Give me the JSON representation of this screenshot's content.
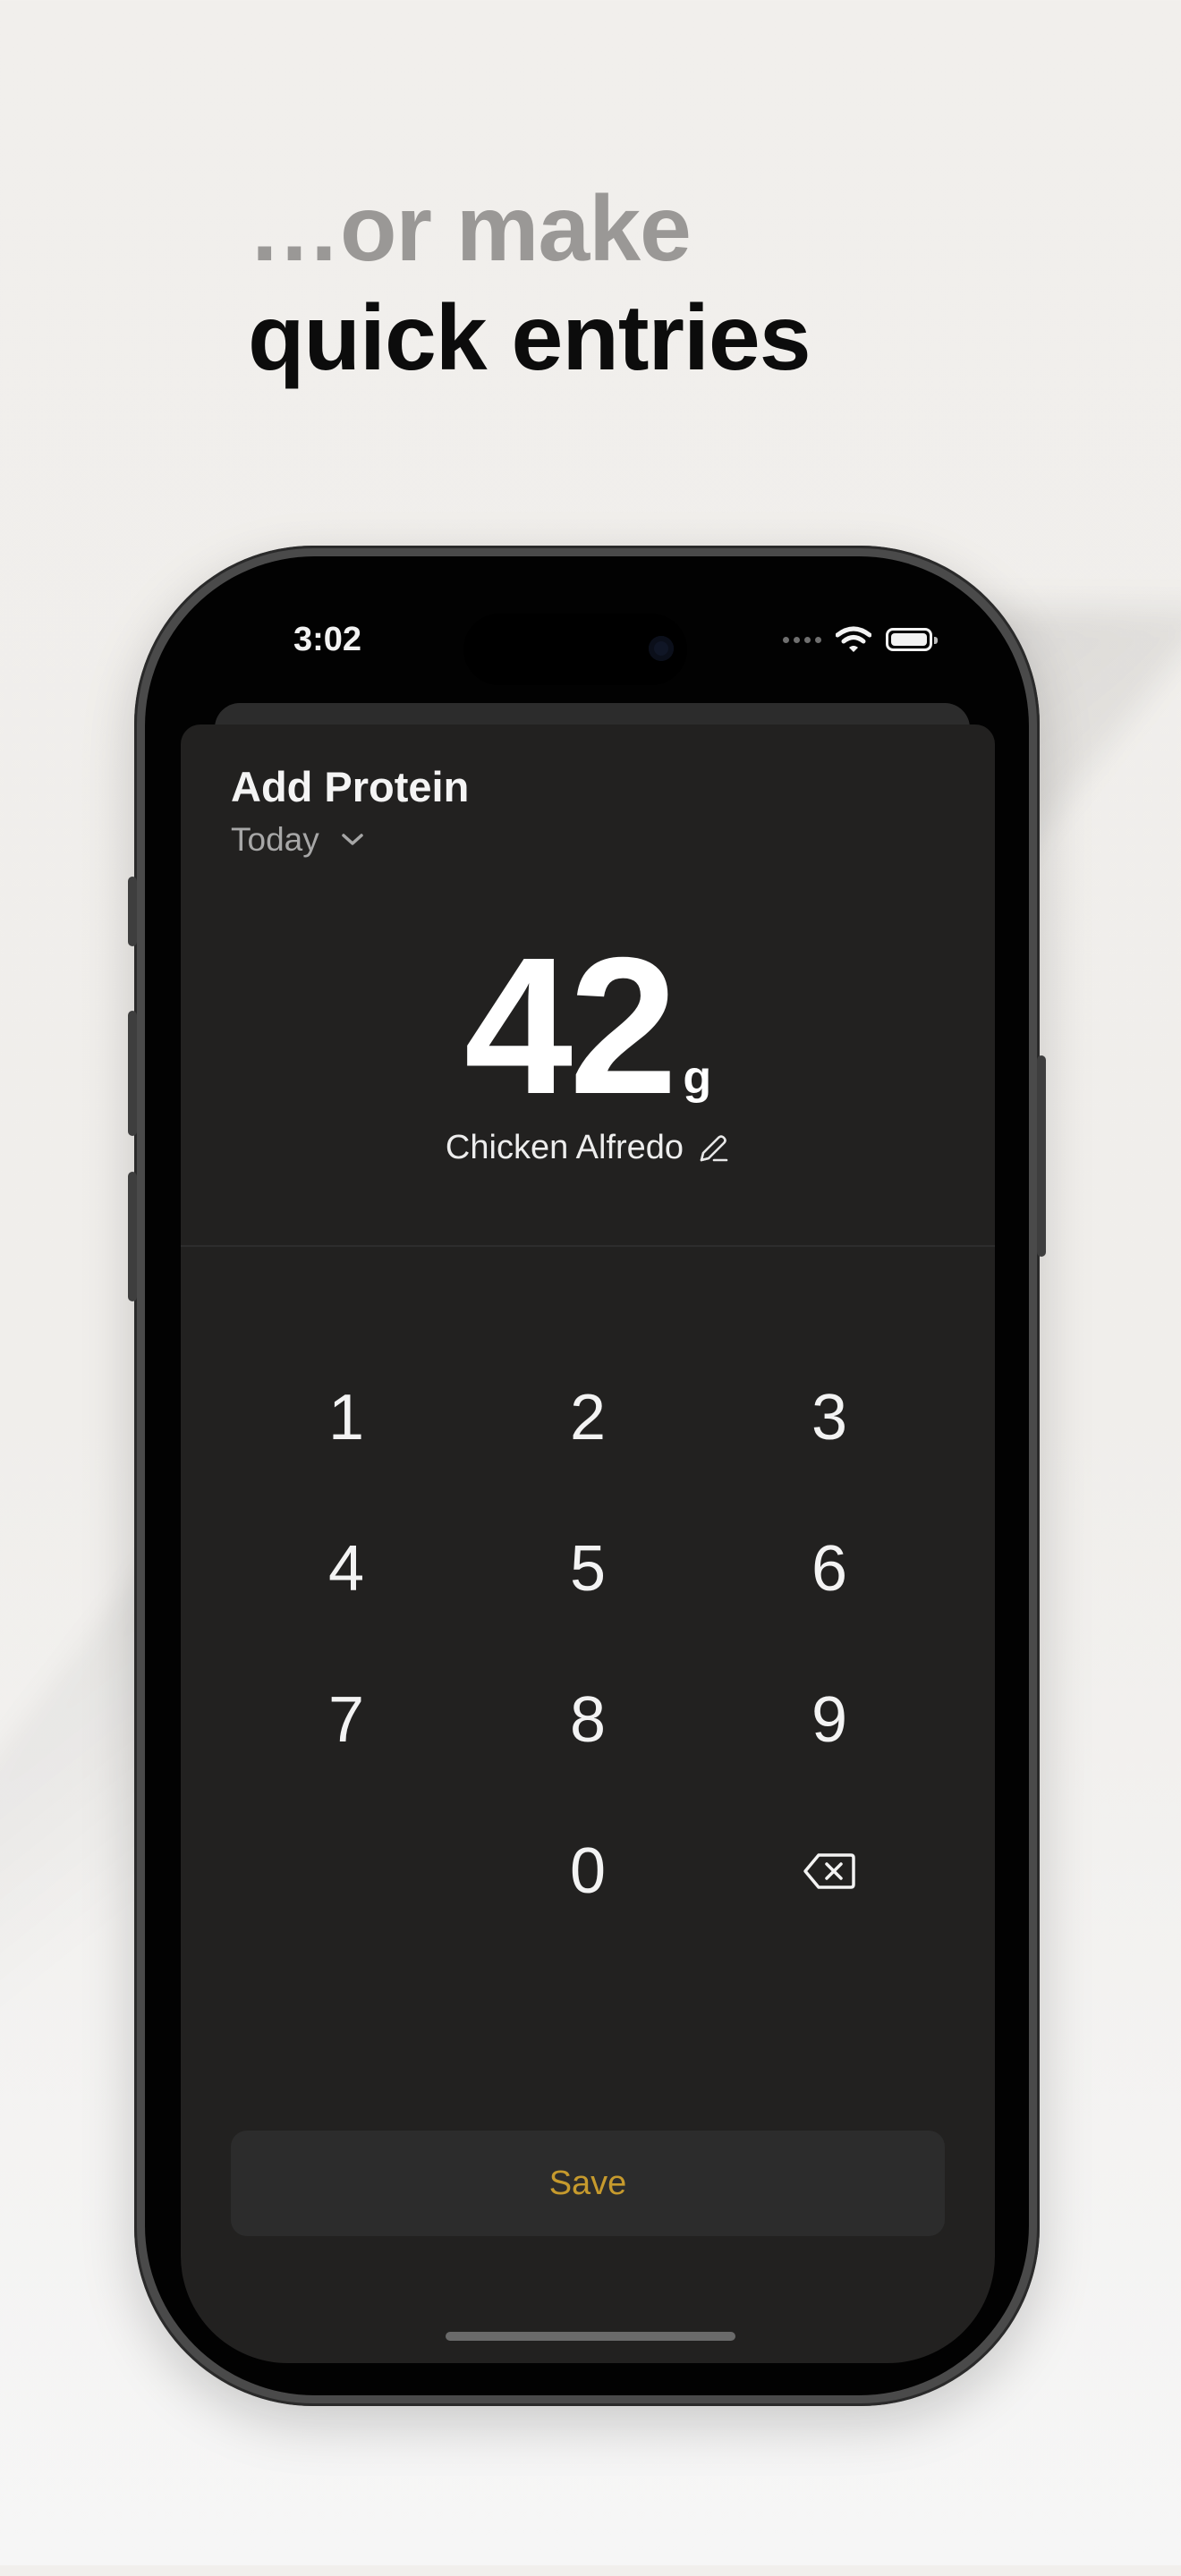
{
  "headline": {
    "line1": "…or make",
    "line2": "quick entries"
  },
  "status_bar": {
    "time": "3:02",
    "icons": [
      "signal-dots-icon",
      "wifi-icon",
      "battery-icon"
    ]
  },
  "sheet": {
    "title": "Add Protein",
    "date_label": "Today",
    "amount": "42",
    "unit": "g",
    "food_name": "Chicken Alfredo"
  },
  "keypad": {
    "keys": [
      "1",
      "2",
      "3",
      "4",
      "5",
      "6",
      "7",
      "8",
      "9",
      "",
      "0"
    ],
    "delete_icon": "backspace-icon"
  },
  "save_label": "Save",
  "colors": {
    "sheet_bg": "#222120",
    "accent": "#c69a2d",
    "button_bg": "#2c2c2c",
    "page_bg": "#f1efec"
  }
}
